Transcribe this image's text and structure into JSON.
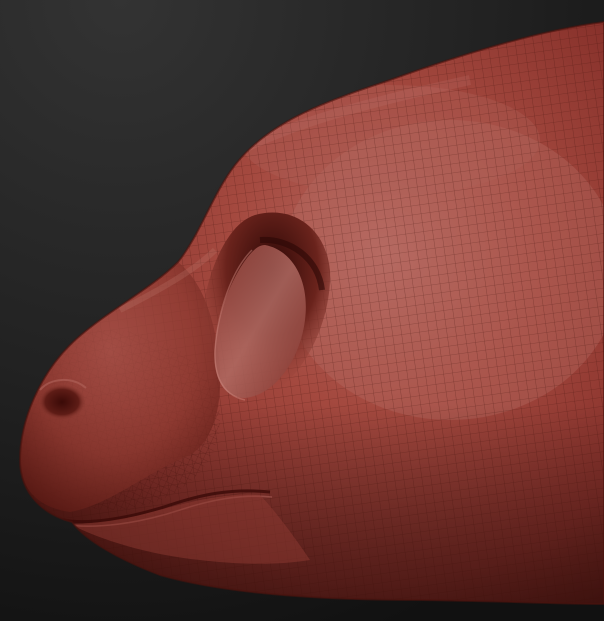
{
  "scene": {
    "subject": "sculpted-animal-head-wireframe",
    "colors": {
      "background_top": "#2f2f2f",
      "background_bottom": "#121212",
      "clay_highlight": "#b86a62",
      "clay_mid": "#9a4238",
      "clay_shadow": "#4e1410",
      "clay_deep": "#2a0907",
      "wire": "#3a0c08"
    }
  }
}
